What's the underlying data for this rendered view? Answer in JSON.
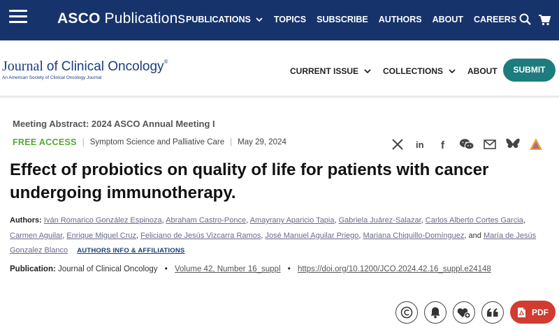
{
  "topbar": {
    "brand_bold": "ASCO",
    "brand_rest": "Publications",
    "nav": [
      "PUBLICATIONS",
      "TOPICS",
      "SUBSCRIBE",
      "AUTHORS",
      "ABOUT",
      "CAREERS"
    ],
    "bg_color": "#16336b"
  },
  "journal": {
    "name_a": "Journal",
    "name_b": "of",
    "name_c": "Clinical Oncology",
    "tagline": "An American Society of Clinical Oncology Journal",
    "nav": [
      "CURRENT ISSUE",
      "COLLECTIONS",
      "ABOUT"
    ],
    "submit_label": "SUBMIT",
    "accent": "#1d7c7e"
  },
  "article": {
    "meeting": "Meeting Abstract: 2024 ASCO Annual Meeting I",
    "access": "FREE ACCESS",
    "section": "Symptom Science and Palliative Care",
    "date": "May 29, 2024",
    "title": "Effect of probiotics on quality of life for patients with cancer undergoing immunotherapy.",
    "authors_label": "Authors:",
    "authors": [
      "Iván Romarico González Espinoza",
      "Abraham Castro-Ponce",
      "Amayrany Aparicio Tapia",
      "Gabriela Juárez-Salazar",
      "Carlos Alberto Cortes Garcia",
      "Carmen Aguilar",
      "Enrique Miguel Cruz",
      "Feliciano de Jesús Vizcarra Ramos",
      "José Manuel Aguilar Priego",
      "Mariana Chiquillo-Domínguez",
      "María de Jesús Gonzalez Blanco"
    ],
    "and_word": "and",
    "affiliations_label": "AUTHORS INFO & AFFILIATIONS",
    "publication_label": "Publication:",
    "publication_journal": "Journal of Clinical Oncology",
    "volume": "Volume 42, Number 16_suppl",
    "doi": "https://doi.org/10.1200/JCO.2024.42.16_suppl.e24148"
  },
  "share_icons": [
    "x-icon",
    "linkedin-icon",
    "facebook-icon",
    "wechat-icon",
    "email-icon",
    "bluesky-icon",
    "altmetric-icon"
  ],
  "actions": {
    "pdf_label": "PDF",
    "pdf_color": "#d23b30"
  }
}
